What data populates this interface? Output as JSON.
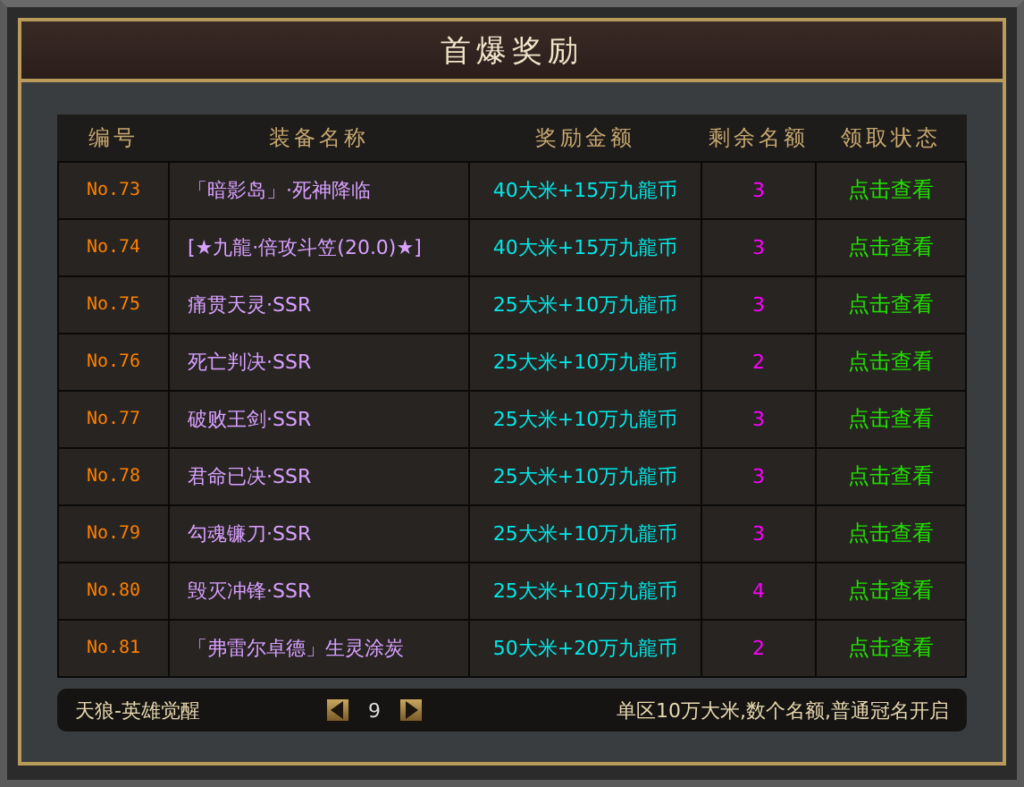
{
  "window": {
    "title": "首爆奖励"
  },
  "table": {
    "columns": [
      "编号",
      "装备名称",
      "奖励金额",
      "剩余名额",
      "领取状态"
    ],
    "rows": [
      {
        "number": "No.73",
        "name": "「暗影岛」·死神降临",
        "reward": "40大米+15万九龍币",
        "remaining": "3",
        "status": "点击查看"
      },
      {
        "number": "No.74",
        "name": "[★九龍·倍攻斗笠(20.0)★]",
        "reward": "40大米+15万九龍币",
        "remaining": "3",
        "status": "点击查看"
      },
      {
        "number": "No.75",
        "name": "痛贯天灵·SSR",
        "reward": "25大米+10万九龍币",
        "remaining": "3",
        "status": "点击查看"
      },
      {
        "number": "No.76",
        "name": "死亡判决·SSR",
        "reward": "25大米+10万九龍币",
        "remaining": "2",
        "status": "点击查看"
      },
      {
        "number": "No.77",
        "name": "破败王剑·SSR",
        "reward": "25大米+10万九龍币",
        "remaining": "3",
        "status": "点击查看"
      },
      {
        "number": "No.78",
        "name": "君命已决·SSR",
        "reward": "25大米+10万九龍币",
        "remaining": "3",
        "status": "点击查看"
      },
      {
        "number": "No.79",
        "name": "勾魂镰刀·SSR",
        "reward": "25大米+10万九龍币",
        "remaining": "3",
        "status": "点击查看"
      },
      {
        "number": "No.80",
        "name": "毁灭冲锋·SSR",
        "reward": "25大米+10万九龍币",
        "remaining": "4",
        "status": "点击查看"
      },
      {
        "number": "No.81",
        "name": "「弗雷尔卓德」生灵涂炭",
        "reward": "50大米+20万九龍币",
        "remaining": "2",
        "status": "点击查看"
      }
    ]
  },
  "footer": {
    "server": "天狼-英雄觉醒",
    "page": "9",
    "note": "单区10万大米,数个名额,普通冠名开启"
  }
}
